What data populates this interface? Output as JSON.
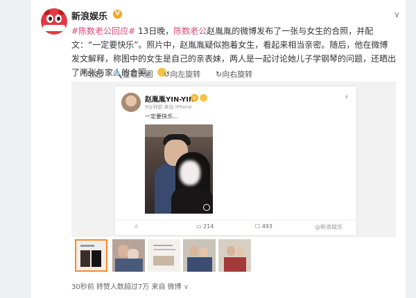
{
  "post": {
    "author": "新浪娱乐",
    "verified_badge": "V",
    "menu_icon": "chevron-down-icon",
    "text_parts": {
      "tag1": "#陈数老公回应#",
      "p1": " 13日晚，",
      "tag2": "陈数老公",
      "p2": "赵胤胤的微博发布了一张与女生的合照，并配文：“一定要快乐”。照片中，赵胤胤疑似抱着女生，看起来相当亲密。随后，他在微博发文解释，称图中的女生是自己的亲表妹，两人是一起讨论她儿子学钢琴的问题，还晒出了两张与家人的合照。"
    },
    "footer": {
      "time": "30秒前",
      "reposts": "转赞人数超过7万",
      "source": "来自 微博",
      "chevron": "∨"
    }
  },
  "image_toolbar": {
    "collapse": "收起",
    "view_large": "查看大图",
    "rotate_left": "向左旋转",
    "rotate_right": "向右旋转"
  },
  "embedded_post": {
    "author": "赵胤胤YIN-YIN",
    "meta": "9分钟前 来自 iPhone",
    "content": "一定要快乐…",
    "menu": "∨",
    "actions": {
      "repost": "☆",
      "comments": "214",
      "likes": "493",
      "watermark": "@新浪娱乐"
    }
  },
  "thumbnails_count": "5",
  "colors": {
    "accent_tag": "#e0457b",
    "brand_red": "#e23a43",
    "selected_thumb": "#f7892b"
  }
}
